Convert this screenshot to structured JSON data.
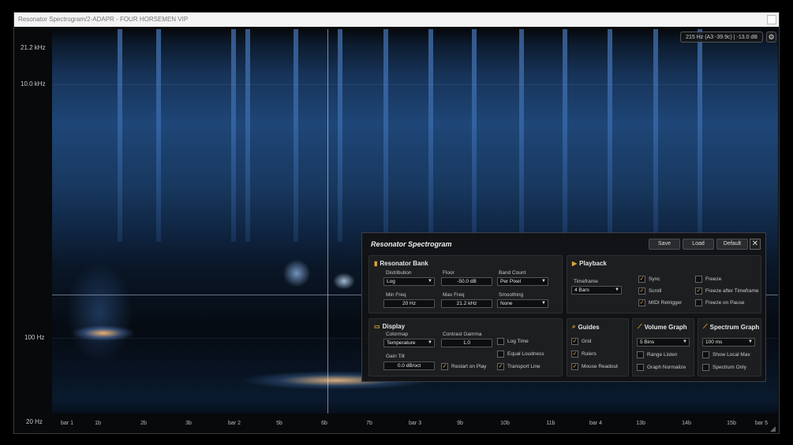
{
  "window": {
    "title": "Resonator Spectrogram/2-ADAPR - FOUR HORSEMEN VIP"
  },
  "y_axis": [
    "21.2 kHz",
    "10.0 kHz",
    "100 Hz",
    "20 Hz"
  ],
  "x_axis": [
    "bar 1",
    "1b",
    "2b",
    "3b",
    "bar 2",
    "5b",
    "6b",
    "7b",
    "bar 3",
    "9b",
    "10b",
    "11b",
    "bar 4",
    "13b",
    "14b",
    "15b",
    "bar 5"
  ],
  "readout": "215 Hz  (A3 -39.9c)  |  -13.0 dB",
  "panel": {
    "title": "Resonator Spectrogram",
    "buttons": {
      "save": "Save",
      "load": "Load",
      "default": "Default"
    },
    "resonator_bank": {
      "title": "Resonator Bank",
      "distribution_label": "Distribution",
      "distribution": "Log",
      "floor_label": "Floor",
      "floor": "-50.0 dB",
      "band_count_label": "Band Count",
      "band_count": "Per Pixel",
      "min_freq_label": "Min Freq",
      "min_freq": "20 Hz",
      "max_freq_label": "Max Freq",
      "max_freq": "21.2 kHz",
      "smoothing_label": "Smoothing",
      "smoothing": "None"
    },
    "playback": {
      "title": "Playback",
      "timeframe_label": "Timeframe",
      "timeframe": "4 Bars",
      "sync": "Sync",
      "scroll": "Scroll",
      "midi_retrigger": "MIDI Retrigger",
      "freeze": "Freeze",
      "freeze_after_timeframe": "Freeze after Timeframe",
      "freeze_on_pause": "Freeze on Pause"
    },
    "display": {
      "title": "Display",
      "colormap_label": "Colormap",
      "colormap": "Temperature",
      "contrast_gamma_label": "Contrast Gamma",
      "contrast_gamma": "1.0",
      "gain_tilt_label": "Gain Tilt",
      "gain_tilt": "0.0 dB/oct",
      "restart_on_play": "Restart on Play",
      "log_time": "Log Time",
      "equal_loudness": "Equal Loudness",
      "transport_line": "Transport Line"
    },
    "guides": {
      "title": "Guides",
      "grid": "Grid",
      "rulers": "Rulers",
      "mouse_readout": "Mouse Readout"
    },
    "volume_graph": {
      "title": "Volume Graph",
      "bins": "5 Bins",
      "range_listen": "Range Listen",
      "graph_normalize": "Graph Normalize"
    },
    "spectrum_graph": {
      "title": "Spectrum Graph",
      "time": "100 ms",
      "show_local_max": "Show Local Max",
      "spectrum_only": "Spectrum Only"
    }
  }
}
